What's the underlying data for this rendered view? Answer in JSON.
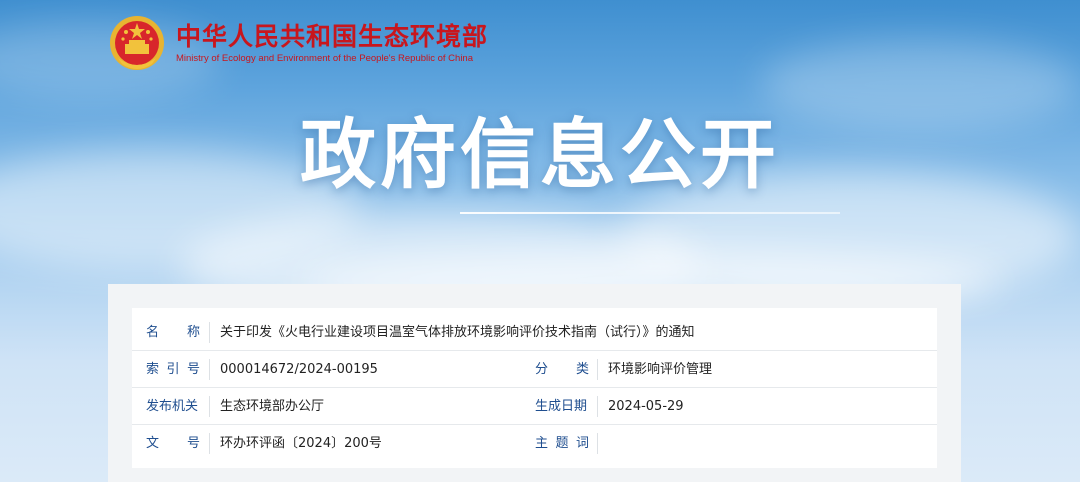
{
  "header": {
    "org_cn": "中华人民共和国生态环境部",
    "org_en": "Ministry of Ecology and Environment of the People's Republic of China"
  },
  "hero": {
    "title": "政府信息公开"
  },
  "meta": {
    "name_label": "名  称",
    "name_value": "关于印发《火电行业建设项目温室气体排放环境影响评价技术指南（试行）》的通知",
    "index_label": "索 引 号",
    "index_value": "000014672/2024-00195",
    "category_label": "分  类",
    "category_value": "环境影响评价管理",
    "publisher_label": "发布机关",
    "publisher_value": "生态环境部办公厅",
    "date_label": "生成日期",
    "date_value": "2024-05-29",
    "docno_label": "文  号",
    "docno_value": "环办环评函〔2024〕200号",
    "subject_label": "主 题 词",
    "subject_value": ""
  },
  "colors": {
    "brand_red": "#c8161d",
    "label_blue": "#1f4e8f"
  }
}
